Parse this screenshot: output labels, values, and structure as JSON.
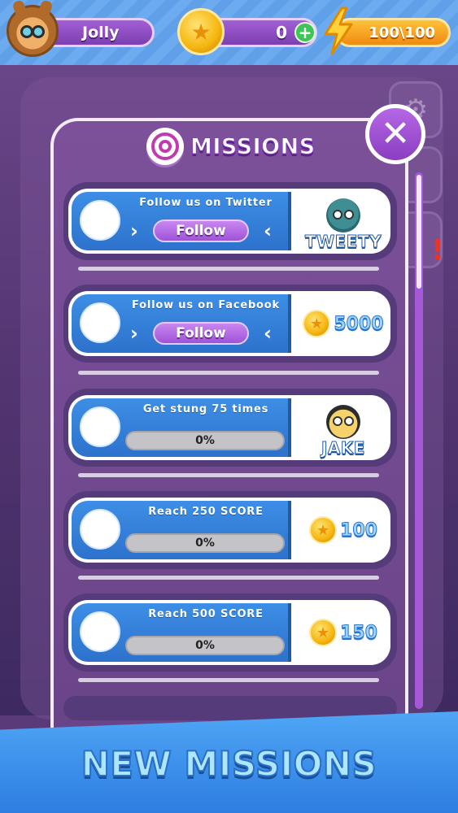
{
  "player": {
    "name": "Jolly"
  },
  "hud": {
    "coins": "0",
    "plus": "+",
    "energy": "100\\100"
  },
  "panel": {
    "title": "MISSIONS",
    "close": "✕"
  },
  "icons": {
    "star": "★",
    "target": "target-icon",
    "bolt": "lightning-bolt-icon",
    "gear": "⚙"
  },
  "missions": [
    {
      "title": "Follow us on Twitter",
      "button": "Follow",
      "left_arrow": "›",
      "right_arrow": "‹",
      "reward_type": "character",
      "reward_name": "TWEETY"
    },
    {
      "title": "Follow us on Facebook",
      "button": "Follow",
      "left_arrow": "›",
      "right_arrow": "‹",
      "reward_type": "coins",
      "reward_amount": "5000"
    },
    {
      "title": "Get stung 75 times",
      "progress": "0%",
      "progress_value": 0,
      "reward_type": "character",
      "reward_name": "JAKE"
    },
    {
      "title": "Reach 250 SCORE",
      "progress": "0%",
      "progress_value": 0,
      "reward_type": "coins",
      "reward_amount": "100"
    },
    {
      "title": "Reach 500 SCORE",
      "progress": "0%",
      "progress_value": 0,
      "reward_type": "coins",
      "reward_amount": "150"
    }
  ],
  "alert": "!",
  "banner": {
    "text": "NEW MISSIONS"
  },
  "colors": {
    "panel": "#7c519a",
    "blue": "#3d8ee6",
    "purple_button": "#a052d8",
    "coin": "#f5b50e",
    "energy": "#f08a10"
  }
}
